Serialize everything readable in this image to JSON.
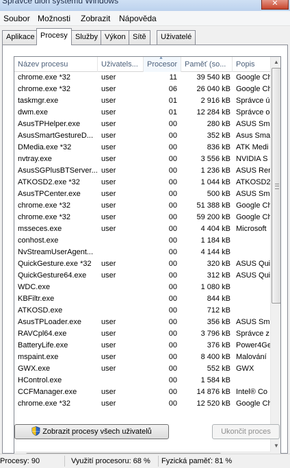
{
  "window": {
    "title": "Správce úloh systému Windows",
    "close_glyph": "✕"
  },
  "menu": [
    "Soubor",
    "Možnosti",
    "Zobrazit",
    "Nápověda"
  ],
  "tabs": [
    {
      "label": "Aplikace"
    },
    {
      "label": "Procesy",
      "active": true
    },
    {
      "label": "Služby"
    },
    {
      "label": "Výkon"
    },
    {
      "label": "Sítě"
    },
    {
      "label": "Uživatelé"
    }
  ],
  "table": {
    "columns": [
      "Název procesu",
      "Uživatels...",
      "Procesor",
      "Paměť (so...",
      "Popis"
    ],
    "sorted_column": "Procesor",
    "rows": [
      [
        "chrome.exe *32",
        "user",
        "11",
        "39 540 kB",
        "Google Ch"
      ],
      [
        "chrome.exe *32",
        "user",
        "06",
        "26 040 kB",
        "Google Ch"
      ],
      [
        "taskmgr.exe",
        "user",
        "01",
        "2 916 kB",
        "Správce ú"
      ],
      [
        "dwm.exe",
        "user",
        "01",
        "12 284 kB",
        "Správce o"
      ],
      [
        "AsusTPHelper.exe",
        "user",
        "00",
        "280 kB",
        "ASUS Sma"
      ],
      [
        "AsusSmartGestureD...",
        "user",
        "00",
        "352 kB",
        "Asus Sma"
      ],
      [
        "DMedia.exe *32",
        "user",
        "00",
        "836 kB",
        "ATK Medi"
      ],
      [
        "nvtray.exe",
        "user",
        "00",
        "3 556 kB",
        "NVIDIA S"
      ],
      [
        "AsusSGPlusBTServer...",
        "user",
        "00",
        "1 236 kB",
        "ASUS Ren"
      ],
      [
        "ATKOSD2.exe *32",
        "user",
        "00",
        "1 044 kB",
        "ATKOSD2"
      ],
      [
        "AsusTPCenter.exe",
        "user",
        "00",
        "500 kB",
        "ASUS Sma"
      ],
      [
        "chrome.exe *32",
        "user",
        "00",
        "51 388 kB",
        "Google Ch"
      ],
      [
        "chrome.exe *32",
        "user",
        "00",
        "59 200 kB",
        "Google Ch"
      ],
      [
        "msseces.exe",
        "user",
        "00",
        "4 404 kB",
        "Microsoft"
      ],
      [
        "conhost.exe",
        "",
        "00",
        "1 184 kB",
        ""
      ],
      [
        "NvStreamUserAgent...",
        "",
        "00",
        "4 144 kB",
        ""
      ],
      [
        "QuickGesture.exe *32",
        "user",
        "00",
        "320 kB",
        "ASUS Quic"
      ],
      [
        "QuickGesture64.exe",
        "user",
        "00",
        "312 kB",
        "ASUS Quic"
      ],
      [
        "WDC.exe",
        "",
        "00",
        "1 080 kB",
        ""
      ],
      [
        "KBFiltr.exe",
        "",
        "00",
        "844 kB",
        ""
      ],
      [
        "ATKOSD.exe",
        "",
        "00",
        "712 kB",
        ""
      ],
      [
        "AsusTPLoader.exe",
        "user",
        "00",
        "356 kB",
        "ASUS Sma"
      ],
      [
        "RAVCpl64.exe",
        "user",
        "00",
        "3 796 kB",
        "Správce z"
      ],
      [
        "BatteryLife.exe",
        "user",
        "00",
        "376 kB",
        "Power4Ge"
      ],
      [
        "mspaint.exe",
        "user",
        "00",
        "8 400 kB",
        "Malování"
      ],
      [
        "GWX.exe",
        "user",
        "00",
        "552 kB",
        "GWX"
      ],
      [
        "HControl.exe",
        "",
        "00",
        "1 584 kB",
        ""
      ],
      [
        "CCFManager.exe",
        "user",
        "00",
        "14 876 kB",
        "Intel® Co"
      ],
      [
        "chrome.exe *32",
        "user",
        "00",
        "12 520 kB",
        "Google Ch"
      ]
    ]
  },
  "scrollbars": {
    "up": "▲",
    "down": "▼",
    "left": "◀",
    "right": "▶"
  },
  "buttons": {
    "show_all": "Zobrazit procesy všech uživatelů",
    "end_process": "Ukončit proces"
  },
  "status": {
    "processes": "Procesy: 90",
    "cpu": "Využití procesoru: 68 %",
    "memory": "Fyzická paměť: 81 %"
  },
  "icons": {
    "shield": "shield-icon",
    "sort": "sort-ascending-icon"
  },
  "colors": {
    "title_bg": "#bcd2ee",
    "close_bg": "#c7452c",
    "header_text": "#4c607a"
  }
}
